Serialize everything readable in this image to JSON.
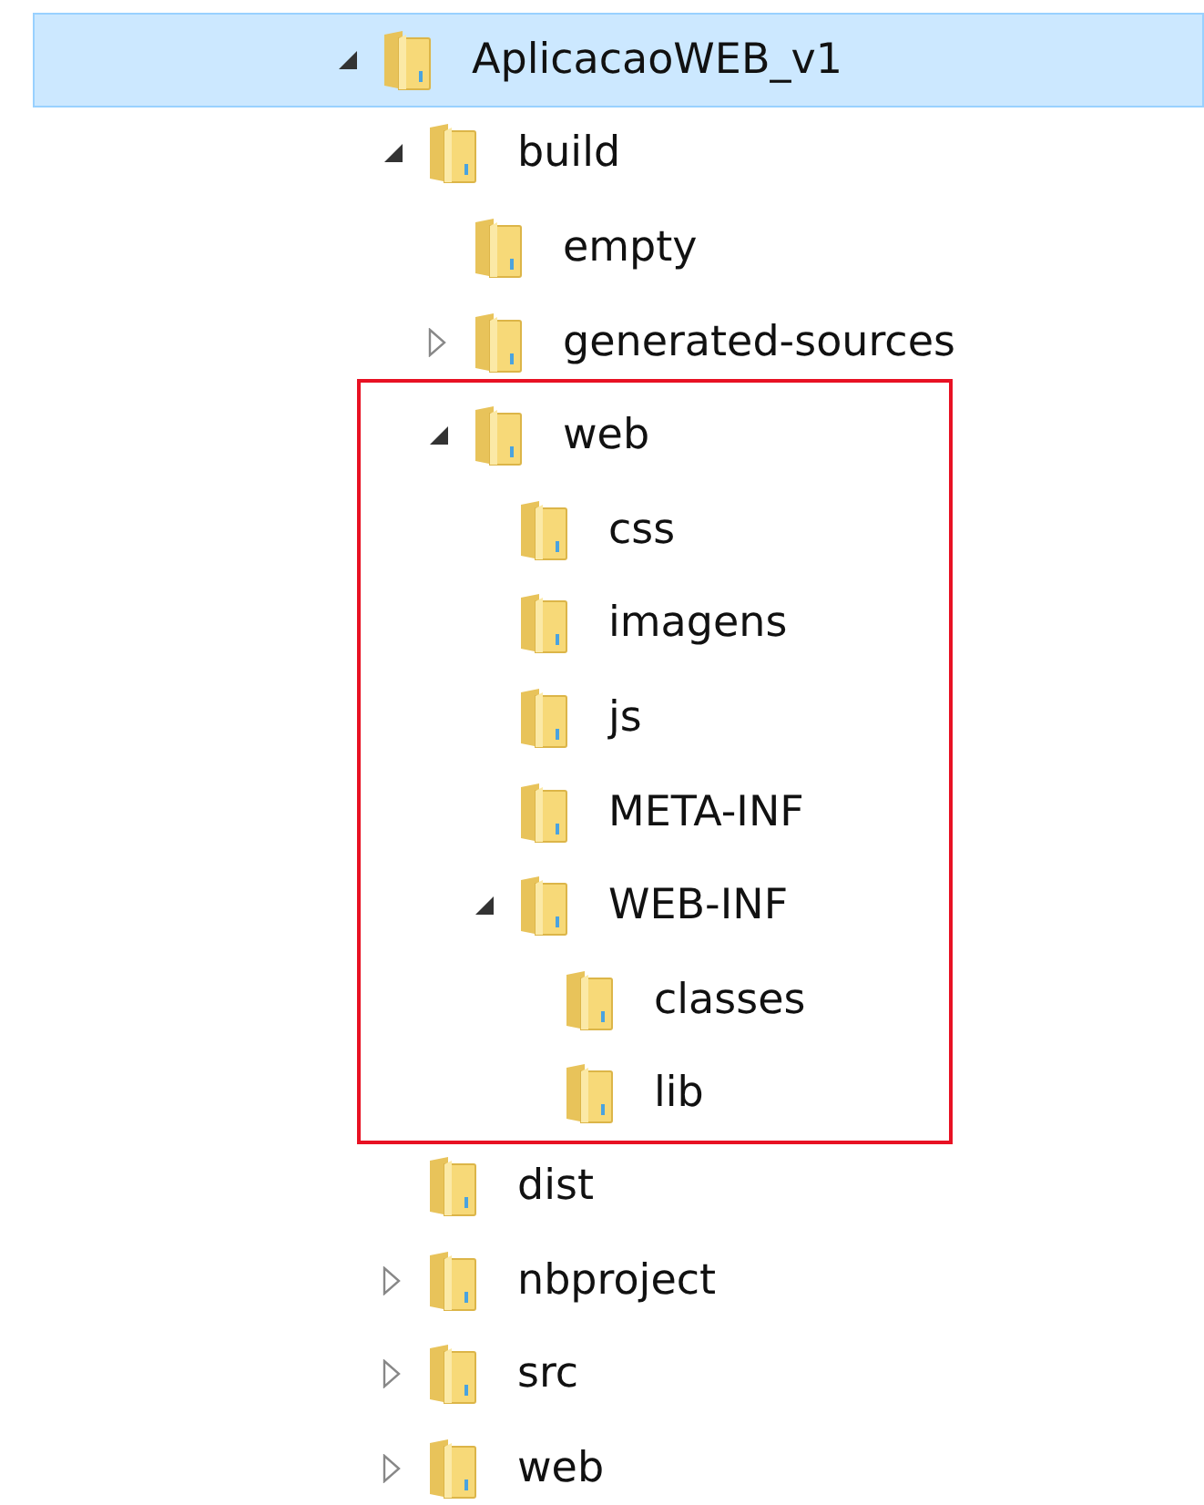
{
  "tree": [
    {
      "label": "AplicacaoWEB_v1",
      "expanded": true,
      "selected": true,
      "children": [
        {
          "label": "build",
          "expanded": true,
          "selected": false,
          "children": [
            {
              "label": "empty",
              "selected": false
            },
            {
              "label": "generated-sources",
              "expanded": false,
              "selected": false
            },
            {
              "label": "web",
              "expanded": true,
              "selected": false,
              "highlighted": true,
              "children": [
                {
                  "label": "css",
                  "selected": false
                },
                {
                  "label": "imagens",
                  "selected": false
                },
                {
                  "label": "js",
                  "selected": false
                },
                {
                  "label": "META-INF",
                  "selected": false
                },
                {
                  "label": "WEB-INF",
                  "expanded": true,
                  "selected": false,
                  "children": [
                    {
                      "label": "classes",
                      "selected": false
                    },
                    {
                      "label": "lib",
                      "selected": false
                    }
                  ]
                }
              ]
            }
          ]
        },
        {
          "label": "dist",
          "selected": false
        },
        {
          "label": "nbproject",
          "expanded": false,
          "selected": false
        },
        {
          "label": "src",
          "expanded": false,
          "selected": false
        },
        {
          "label": "web",
          "expanded": false,
          "selected": false
        }
      ]
    }
  ]
}
